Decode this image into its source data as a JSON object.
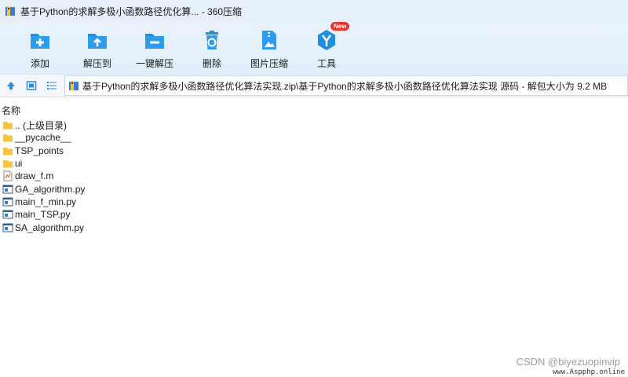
{
  "window": {
    "title": "基于Python的求解多极小函数路径优化算... - 360压缩"
  },
  "toolbar": {
    "buttons": [
      {
        "label": "添加",
        "icon": "add-icon"
      },
      {
        "label": "解压到",
        "icon": "extract-to-icon"
      },
      {
        "label": "一键解压",
        "icon": "one-click-extract-icon"
      },
      {
        "label": "删除",
        "icon": "recycle-delete-icon"
      },
      {
        "label": "图片压缩",
        "icon": "image-compress-icon"
      },
      {
        "label": "工具",
        "icon": "tools-icon",
        "badge": "New"
      }
    ]
  },
  "address": {
    "path": "基于Python的求解多极小函数路径优化算法实现.zip\\基于Python的求解多极小函数路径优化算法实现 源码 - 解包大小为 9.2 MB"
  },
  "columns": {
    "name": "名称"
  },
  "files": [
    {
      "name": ".. (上级目录)",
      "type": "parent"
    },
    {
      "name": "__pycache__",
      "type": "folder"
    },
    {
      "name": "TSP_points",
      "type": "folder"
    },
    {
      "name": "ui",
      "type": "folder"
    },
    {
      "name": "draw_f.m",
      "type": "m"
    },
    {
      "name": "GA_algorithm.py",
      "type": "py"
    },
    {
      "name": "main_f_min.py",
      "type": "py"
    },
    {
      "name": "main_TSP.py",
      "type": "py"
    },
    {
      "name": "SA_algorithm.py",
      "type": "py"
    }
  ],
  "watermark": "CSDN @biyezuopinvip",
  "watermark2": "www.Aspphp.online",
  "colors": {
    "accent": "#1f8fe0",
    "folder": "#f5c542"
  }
}
